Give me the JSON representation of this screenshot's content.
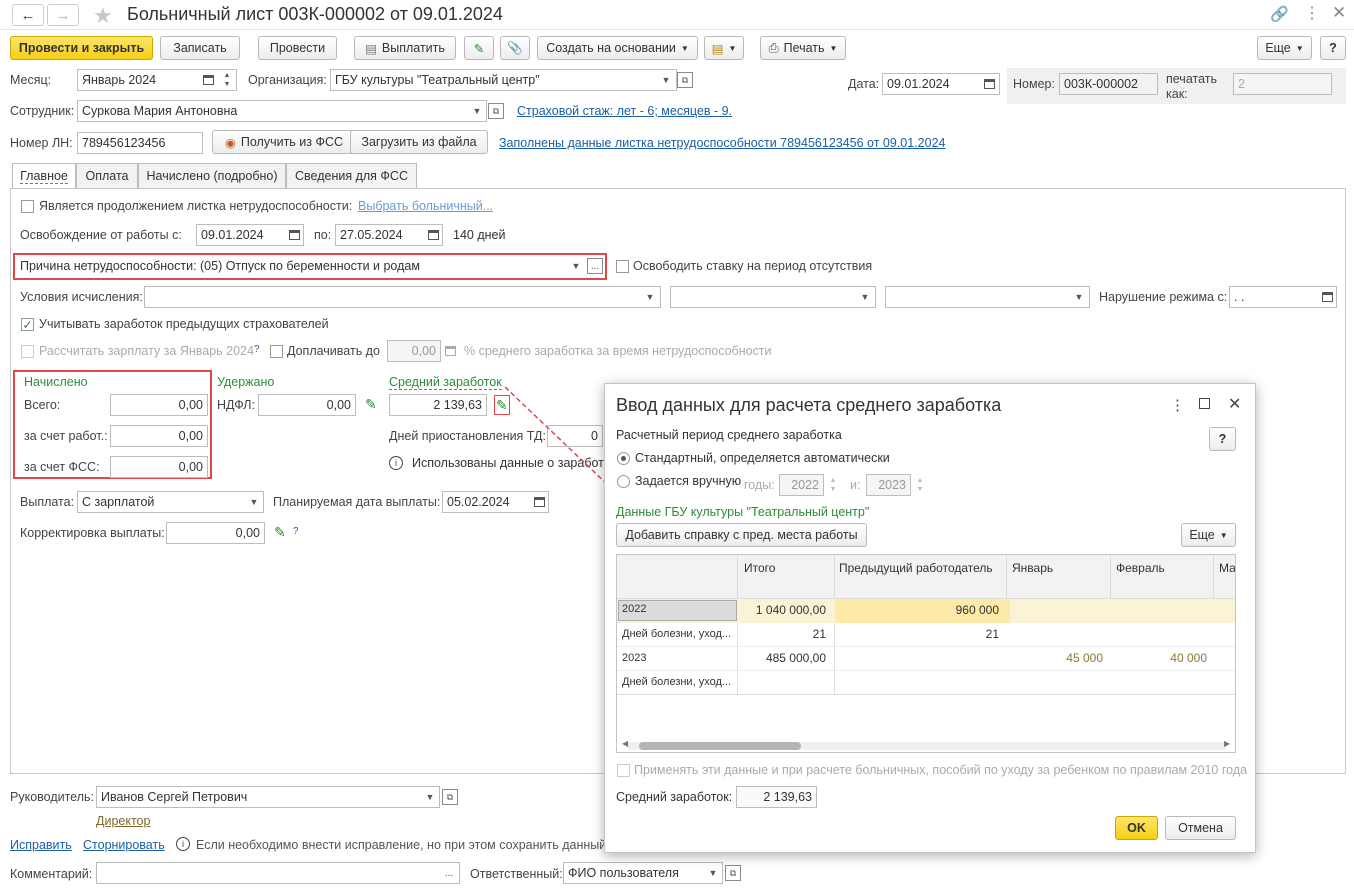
{
  "window": {
    "title": "Больничный лист 003К-000002 от 09.01.2024"
  },
  "toolbar": {
    "post_close": "Провести и закрыть",
    "save": "Записать",
    "post": "Провести",
    "pay": "Выплатить",
    "create_based": "Создать на основании",
    "print": "Печать",
    "more": "Еще",
    "help": "?"
  },
  "header": {
    "month_label": "Месяц:",
    "month_value": "Январь 2024",
    "org_label": "Организация:",
    "org_value": "ГБУ культуры \"Театральный центр\"",
    "date_label": "Дата:",
    "date_value": "09.01.2024",
    "number_label": "Номер:",
    "number_value": "003К-000002",
    "print_as_label": "печатать как:",
    "print_as_value": "2",
    "employee_label": "Сотрудник:",
    "employee_value": "Суркова Мария Антоновна",
    "insurance_link": "Страховой стаж: лет - 6; месяцев - 9.",
    "ln_label": "Номер ЛН:",
    "ln_value": "789456123456",
    "get_fss": "Получить из ФСС",
    "load_file": "Загрузить из файла",
    "filled_link": "Заполнены данные листка нетрудоспособности 789456123456 от 09.01.2024"
  },
  "tabs": [
    "Главное",
    "Оплата",
    "Начислено (подробно)",
    "Сведения для ФСС"
  ],
  "main": {
    "continuation_label": "Является продолжением листка нетрудоспособности:",
    "choose_link": "Выбрать больничный...",
    "release_label": "Освобождение от работы с:",
    "release_from": "09.01.2024",
    "to_label": "по:",
    "release_to": "27.05.2024",
    "days": "140 дней",
    "reason_label": "Причина нетрудоспособности:",
    "reason_value": "(05) Отпуск по беременности и родам",
    "free_rate_label": "Освободить ставку на период отсутствия",
    "conditions_label": "Условия исчисления:",
    "violation_label": "Нарушение режима с:",
    "violation_value": " .  .",
    "prev_insurers_label": "Учитывать заработок предыдущих страхователей",
    "calc_salary_label": "Рассчитать зарплату за Январь 2024",
    "q": "?",
    "extra_pay_label": "Доплачивать до",
    "extra_pay_value": "0,00",
    "extra_pay_suffix": "% среднего заработка за время нетрудоспособности",
    "accrued_title": "Начислено",
    "total_label": "Всего:",
    "total_value": "0,00",
    "employer_label": "за счет работ.:",
    "employer_value": "0,00",
    "fss_label": "за счет ФСС:",
    "fss_value": "0,00",
    "withheld_title": "Удержано",
    "ndfl_label": "НДФЛ:",
    "ndfl_value": "0,00",
    "avg_title": "Средний заработок",
    "avg_value": "2 139,63",
    "suspend_label": "Дней приостановления ТД:",
    "suspend_value": "0",
    "used_data_label": "Использованы данные о заработ",
    "payout_label": "Выплата:",
    "payout_value": "С зарплатой",
    "planned_label": "Планируемая дата выплаты:",
    "planned_value": "05.02.2024",
    "correction_label": "Корректировка выплаты:",
    "correction_value": "0,00"
  },
  "footer": {
    "manager_label": "Руководитель:",
    "manager_value": "Иванов Сергей Петрович",
    "manager_role": "Директор",
    "fix_link": "Исправить",
    "reverse_link": "Сторнировать",
    "fix_note": "Если необходимо внести исправление, но при этом сохранить данный",
    "comment_label": "Комментарий:",
    "responsible_label": "Ответственный:",
    "responsible_value": "ФИО пользователя"
  },
  "dialog": {
    "title": "Ввод данных для расчета среднего заработка",
    "period_label": "Расчетный период среднего заработка",
    "standard_label": "Стандартный, определяется автоматически",
    "manual_label": "Задается вручную",
    "years_label": "годы:",
    "year1": "2022",
    "and_label": "и:",
    "year2": "2023",
    "org_data_label": "Данные ГБУ культуры \"Театральный центр\"",
    "add_cert": "Добавить справку с пред. места работы",
    "more": "Еще",
    "help": "?",
    "columns": [
      "Итого",
      "Предыдущий работодатель",
      "Январь",
      "Февраль",
      "Ма"
    ],
    "rows": [
      {
        "label": "2022",
        "total": "1 040 000,00",
        "prev": "960 000",
        "jan": "",
        "feb": ""
      },
      {
        "label": "Дней болезни, уход...",
        "total": "21",
        "prev": "21",
        "jan": "",
        "feb": ""
      },
      {
        "label": "2023",
        "total": "485 000,00",
        "prev": "",
        "jan": "45 000",
        "feb": "40 000"
      },
      {
        "label": "Дней болезни, уход...",
        "total": "",
        "prev": "",
        "jan": "",
        "feb": ""
      }
    ],
    "apply_label": "Применять эти данные и при расчете больничных, пособий по уходу за ребенком по правилам 2010 года",
    "avg_label": "Средний заработок:",
    "avg_value": "2 139,63",
    "ok": "OK",
    "cancel": "Отмена"
  }
}
